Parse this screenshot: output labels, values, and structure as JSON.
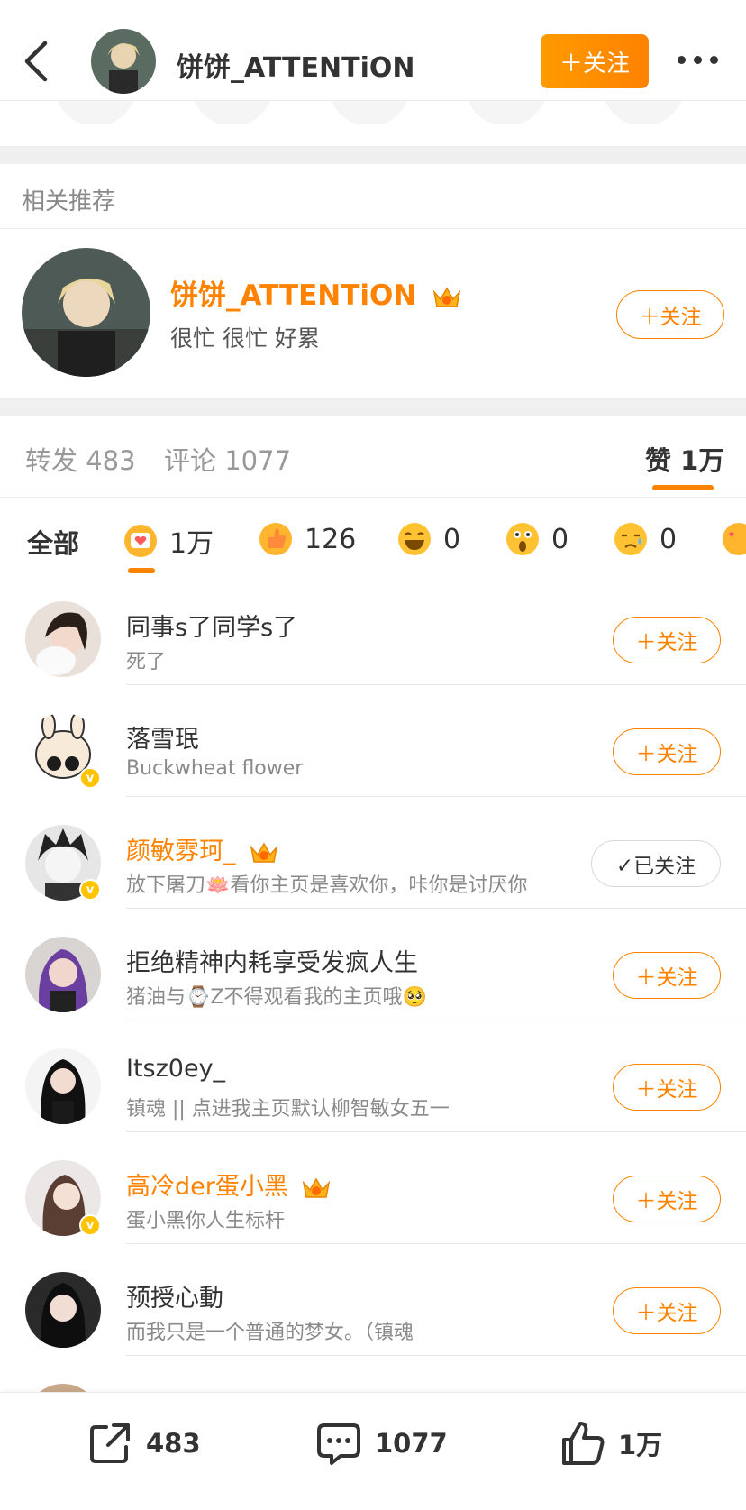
{
  "header": {
    "username": "饼饼_ATTENTiON",
    "follow_label": "＋关注"
  },
  "related": {
    "section_title": "相关推荐",
    "name": "饼饼_ATTENTiON",
    "desc": "很忙 很忙 好累",
    "follow_label": "＋关注"
  },
  "tabs": {
    "repost": "转发 483",
    "comment": "评论 1077",
    "like": "赞 1万"
  },
  "reactions": {
    "all": "全部",
    "items": [
      {
        "icon": "heart-face-icon",
        "count": "1万"
      },
      {
        "icon": "thumbs-up-icon",
        "count": "126"
      },
      {
        "icon": "laughing-icon",
        "count": "0"
      },
      {
        "icon": "surprised-icon",
        "count": "0"
      },
      {
        "icon": "sad-icon",
        "count": "0"
      }
    ]
  },
  "users": [
    {
      "name": "同事s了同学s了",
      "desc": "死了",
      "button": "＋关注"
    },
    {
      "name": "落雪珉",
      "desc": "Buckwheat flower",
      "button": "＋关注"
    },
    {
      "name": "颜敏雰珂_",
      "desc": "放下屠刀🪷看你主页是喜欢你，咔你是讨厌你",
      "button": "✓已关注"
    },
    {
      "name": "拒绝精神内耗享受发疯人生",
      "desc": "猪油与⌚Z不得观看我的主页哦🥺",
      "button": "＋关注"
    },
    {
      "name": "Itsz0ey_",
      "desc": "镇魂 || 点进我主页默认柳智敏女五一",
      "button": "＋关注"
    },
    {
      "name": "高冷der蛋小黑",
      "desc": "蛋小黑你人生标杆",
      "button": "＋关注"
    },
    {
      "name": "预授心動",
      "desc": "而我只是一个普通的梦女。（镇魂",
      "button": "＋关注"
    }
  ],
  "bottom": {
    "repost": "483",
    "comment": "1077",
    "like": "1万"
  },
  "colors": {
    "accent": "#ff8200",
    "bg_gap": "#f0f0f0"
  }
}
